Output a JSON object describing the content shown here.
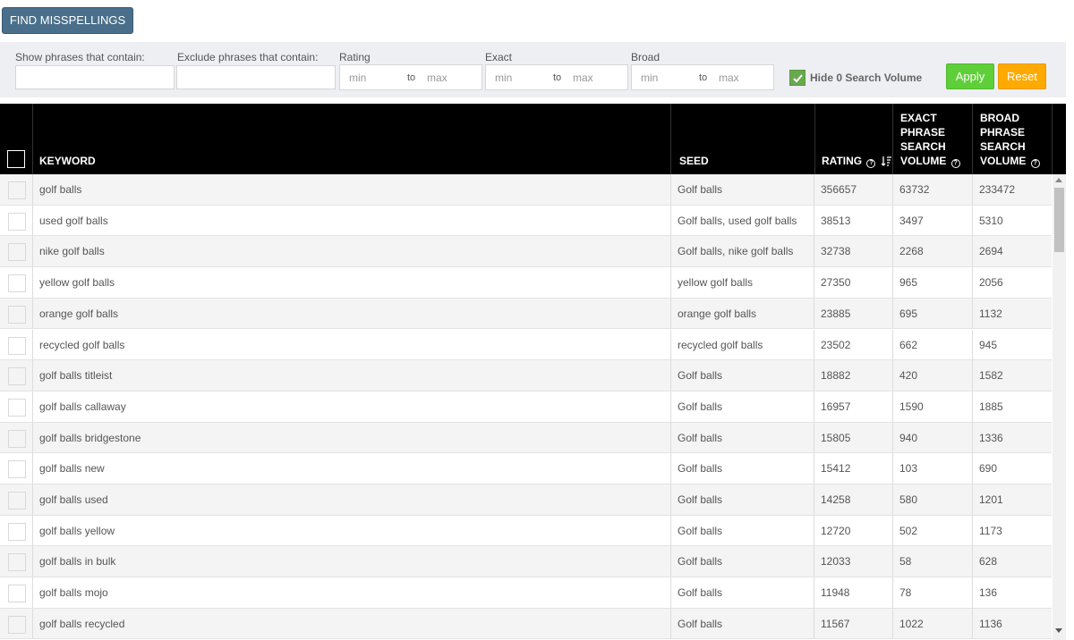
{
  "toolbar": {
    "find_misspellings_label": "FIND MISSPELLINGS"
  },
  "filters": {
    "show_label": "Show phrases that contain:",
    "exclude_label": "Exclude phrases that contain:",
    "rating_label": "Rating",
    "exact_label": "Exact",
    "broad_label": "Broad",
    "min_placeholder": "min",
    "to_label": "to",
    "max_placeholder": "max",
    "hide_zero_label": "Hide 0 Search Volume",
    "hide_zero_checked": true,
    "apply_label": "Apply",
    "reset_label": "Reset"
  },
  "colors": {
    "apply": "#5fcf39",
    "reset": "#ffaa00",
    "find": "#4a6f8a",
    "header_bg": "#000000"
  },
  "table": {
    "headers": {
      "keyword": "KEYWORD",
      "seed": "SEED",
      "rating": "RATING",
      "exact_l1": "EXACT",
      "exact_l2": "PHRASE",
      "exact_l3": "SEARCH",
      "exact_l4": "VOLUME",
      "broad_l1": "BROAD",
      "broad_l2": "PHRASE",
      "broad_l3": "SEARCH",
      "broad_l4": "VOLUME",
      "help_glyph": "?"
    },
    "rows": [
      {
        "keyword": "golf balls",
        "seed": "Golf balls",
        "rating": "356657",
        "exact": "63732",
        "broad": "233472"
      },
      {
        "keyword": "used golf balls",
        "seed": "Golf balls, used golf balls",
        "rating": "38513",
        "exact": "3497",
        "broad": "5310"
      },
      {
        "keyword": "nike golf balls",
        "seed": "Golf balls, nike golf balls",
        "rating": "32738",
        "exact": "2268",
        "broad": "2694"
      },
      {
        "keyword": "yellow golf balls",
        "seed": "yellow golf balls",
        "rating": "27350",
        "exact": "965",
        "broad": "2056"
      },
      {
        "keyword": "orange golf balls",
        "seed": "orange golf balls",
        "rating": "23885",
        "exact": "695",
        "broad": "1132"
      },
      {
        "keyword": "recycled golf balls",
        "seed": "recycled golf balls",
        "rating": "23502",
        "exact": "662",
        "broad": "945"
      },
      {
        "keyword": "golf balls titleist",
        "seed": "Golf balls",
        "rating": "18882",
        "exact": "420",
        "broad": "1582"
      },
      {
        "keyword": "golf balls callaway",
        "seed": "Golf balls",
        "rating": "16957",
        "exact": "1590",
        "broad": "1885"
      },
      {
        "keyword": "golf balls bridgestone",
        "seed": "Golf balls",
        "rating": "15805",
        "exact": "940",
        "broad": "1336"
      },
      {
        "keyword": "golf balls new",
        "seed": "Golf balls",
        "rating": "15412",
        "exact": "103",
        "broad": "690"
      },
      {
        "keyword": "golf balls used",
        "seed": "Golf balls",
        "rating": "14258",
        "exact": "580",
        "broad": "1201"
      },
      {
        "keyword": "golf balls yellow",
        "seed": "Golf balls",
        "rating": "12720",
        "exact": "502",
        "broad": "1173"
      },
      {
        "keyword": "golf balls in bulk",
        "seed": "Golf balls",
        "rating": "12033",
        "exact": "58",
        "broad": "628"
      },
      {
        "keyword": "golf balls mojo",
        "seed": "Golf balls",
        "rating": "11948",
        "exact": "78",
        "broad": "136"
      },
      {
        "keyword": "golf balls recycled",
        "seed": "Golf balls",
        "rating": "11567",
        "exact": "1022",
        "broad": "1136"
      }
    ]
  }
}
